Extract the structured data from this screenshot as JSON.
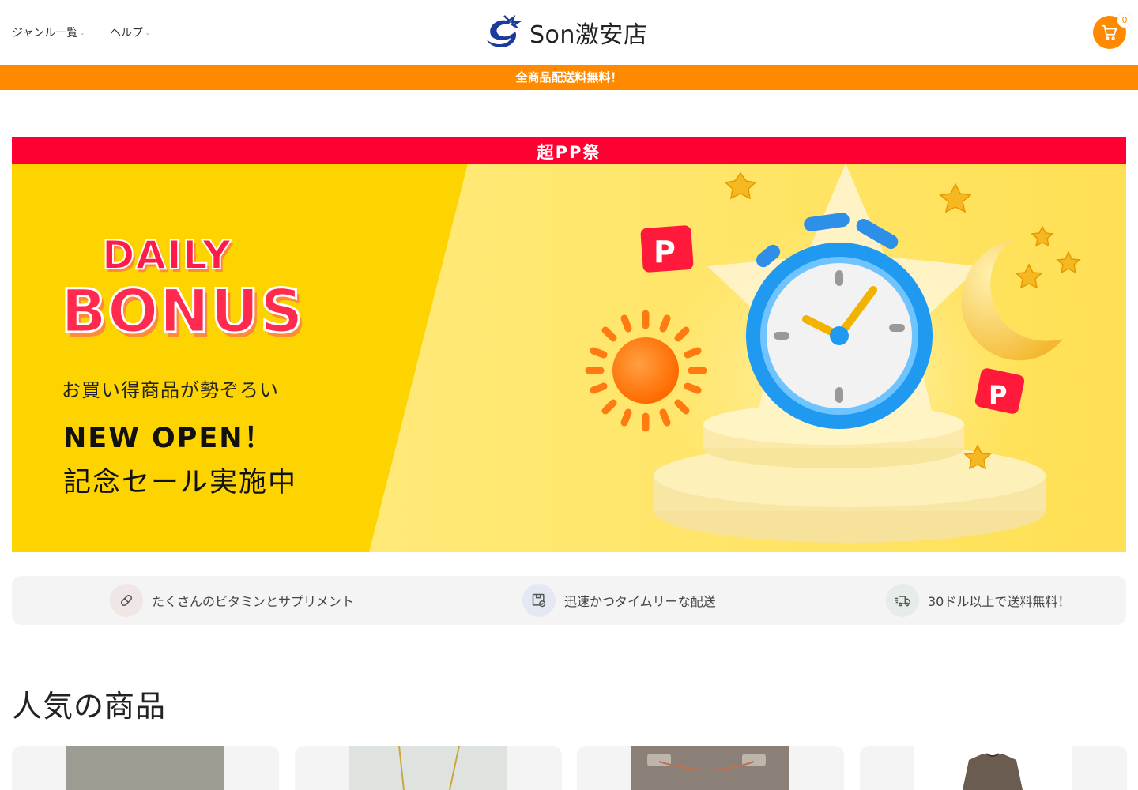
{
  "header": {
    "nav": [
      {
        "label": "ジャンル一覧"
      },
      {
        "label": "ヘルプ"
      }
    ],
    "logo_text": "Son激安店",
    "cart_count": "0"
  },
  "announcement": "全商品配送料無料！",
  "hero": {
    "top_label": "超PP祭",
    "badge_word1": "DAILY",
    "badge_word2": "BONUS",
    "line1": "お買い得商品が勢ぞろい",
    "line2": "NEW OPEN！",
    "line3": "記念セール実施中"
  },
  "features": [
    {
      "label": "たくさんのビタミンとサプリメント",
      "icon": "pill-icon"
    },
    {
      "label": "迅速かつタイムリーな配送",
      "icon": "package-check-icon"
    },
    {
      "label": "30ドル以上で送料無料！",
      "icon": "truck-icon"
    }
  ],
  "popular": {
    "title": "人気の商品",
    "products": [
      {
        "image": "product-image-gray"
      },
      {
        "image": "product-image-necklace"
      },
      {
        "image": "product-image-chain"
      },
      {
        "image": "product-image-shirt"
      }
    ]
  },
  "colors": {
    "accent": "#ff8a00",
    "hero_bg": "#fdd400",
    "hero_bar": "#ff0033"
  }
}
